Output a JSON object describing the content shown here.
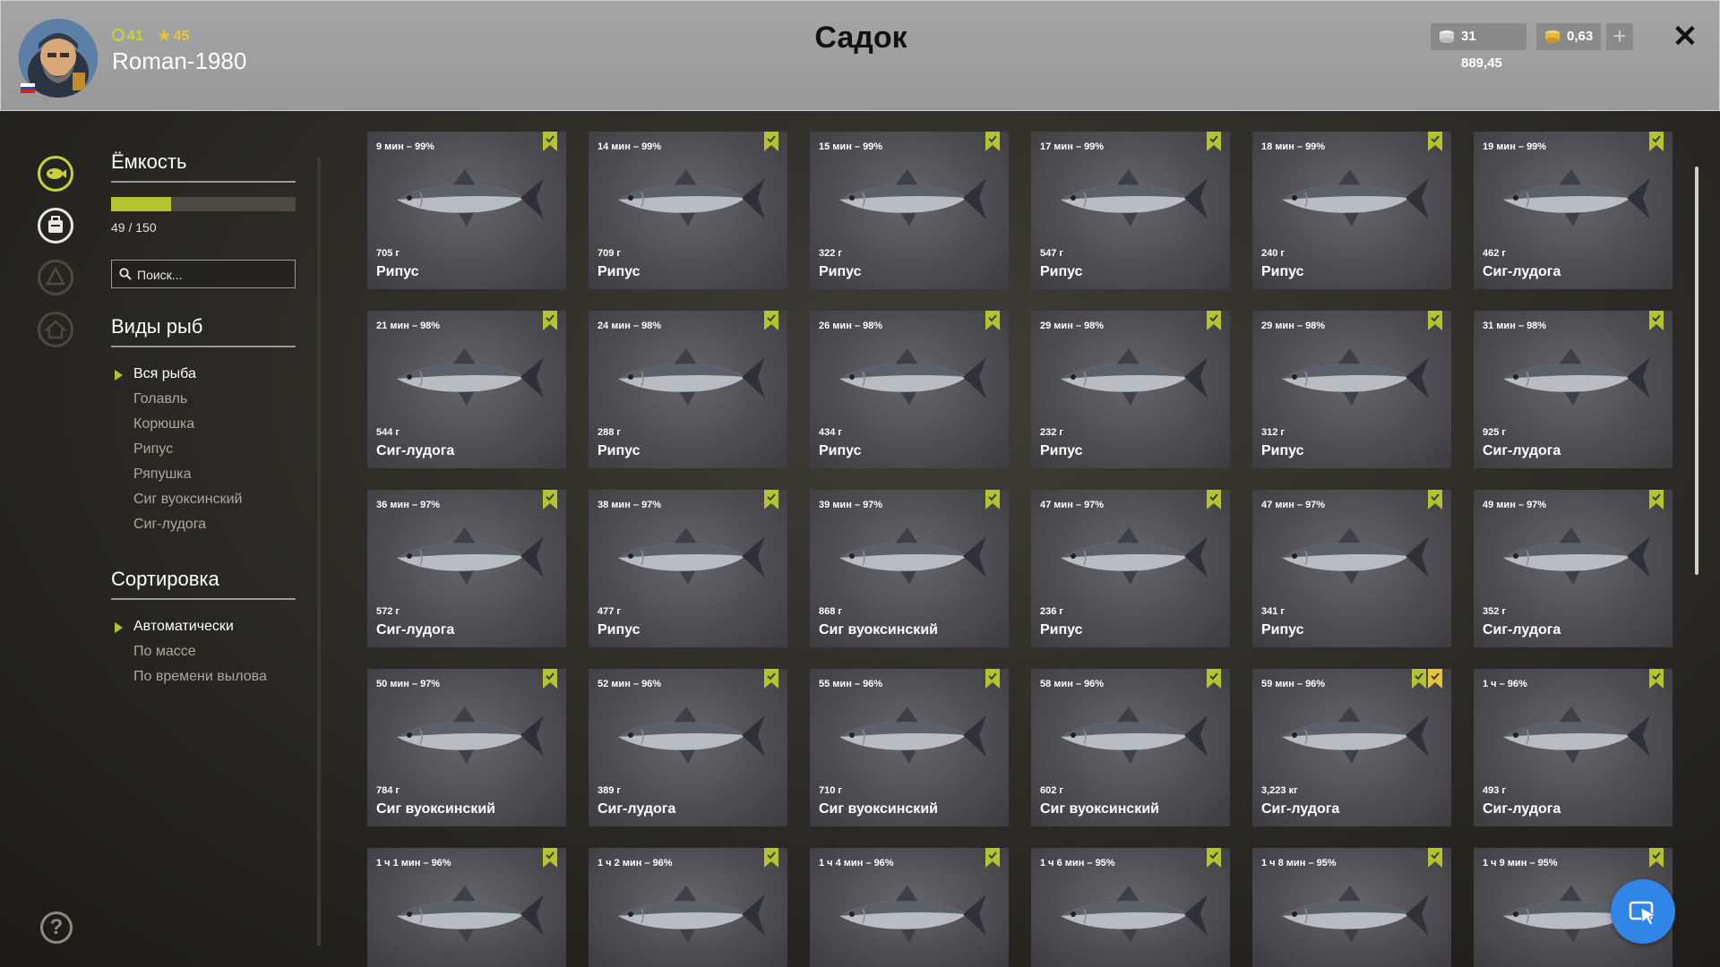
{
  "header": {
    "title": "Садок",
    "username": "Roman-1980",
    "level": "41",
    "rank": "45",
    "silver": "31 889,45",
    "gold": "0,63",
    "add_label": "+",
    "close_label": "✕"
  },
  "filters": {
    "capacity_title": "Ёмкость",
    "capacity_text": "49 / 150",
    "capacity_fraction": 0.3267,
    "search_placeholder": "Поиск...",
    "species_title": "Виды рыб",
    "species": [
      "Вся рыба",
      "Голавль",
      "Корюшка",
      "Рипус",
      "Ряпушка",
      "Сиг вуоксинский",
      "Сиг-лудога"
    ],
    "species_active": 0,
    "sort_title": "Сортировка",
    "sort": [
      "Автоматически",
      "По массе",
      "По времени вылова"
    ],
    "sort_active": 0
  },
  "help_label": "?",
  "colors": {
    "accent": "#b3c42f",
    "header": "#9e9e9e",
    "bookmark": "#b3c42f",
    "bookmark_gold": "#e7c63b",
    "fab": "#2f86e6"
  },
  "fish": [
    {
      "time": "9 мин – 99%",
      "weight": "705 г",
      "name": "Рипус",
      "bookmarks": 1
    },
    {
      "time": "14 мин – 99%",
      "weight": "709 г",
      "name": "Рипус",
      "bookmarks": 1
    },
    {
      "time": "15 мин – 99%",
      "weight": "322 г",
      "name": "Рипус",
      "bookmarks": 1
    },
    {
      "time": "17 мин – 99%",
      "weight": "547 г",
      "name": "Рипус",
      "bookmarks": 1
    },
    {
      "time": "18 мин – 99%",
      "weight": "240 г",
      "name": "Рипус",
      "bookmarks": 1
    },
    {
      "time": "19 мин – 99%",
      "weight": "462 г",
      "name": "Сиг-лудога",
      "bookmarks": 1
    },
    {
      "time": "21 мин – 98%",
      "weight": "544 г",
      "name": "Сиг-лудога",
      "bookmarks": 1
    },
    {
      "time": "24 мин – 98%",
      "weight": "288 г",
      "name": "Рипус",
      "bookmarks": 1
    },
    {
      "time": "26 мин – 98%",
      "weight": "434 г",
      "name": "Рипус",
      "bookmarks": 1
    },
    {
      "time": "29 мин – 98%",
      "weight": "232 г",
      "name": "Рипус",
      "bookmarks": 1
    },
    {
      "time": "29 мин – 98%",
      "weight": "312 г",
      "name": "Рипус",
      "bookmarks": 1
    },
    {
      "time": "31 мин – 98%",
      "weight": "925 г",
      "name": "Сиг-лудога",
      "bookmarks": 1
    },
    {
      "time": "36 мин – 97%",
      "weight": "572 г",
      "name": "Сиг-лудога",
      "bookmarks": 1
    },
    {
      "time": "38 мин – 97%",
      "weight": "477 г",
      "name": "Рипус",
      "bookmarks": 1
    },
    {
      "time": "39 мин – 97%",
      "weight": "868 г",
      "name": "Сиг вуоксинский",
      "bookmarks": 1
    },
    {
      "time": "47 мин – 97%",
      "weight": "236 г",
      "name": "Рипус",
      "bookmarks": 1
    },
    {
      "time": "47 мин – 97%",
      "weight": "341 г",
      "name": "Рипус",
      "bookmarks": 1
    },
    {
      "time": "49 мин – 97%",
      "weight": "352 г",
      "name": "Сиг-лудога",
      "bookmarks": 1
    },
    {
      "time": "50 мин – 97%",
      "weight": "784 г",
      "name": "Сиг вуоксинский",
      "bookmarks": 1
    },
    {
      "time": "52 мин – 96%",
      "weight": "389 г",
      "name": "Сиг-лудога",
      "bookmarks": 1
    },
    {
      "time": "55 мин – 96%",
      "weight": "710 г",
      "name": "Сиг вуоксинский",
      "bookmarks": 1
    },
    {
      "time": "58 мин – 96%",
      "weight": "602 г",
      "name": "Сиг вуоксинский",
      "bookmarks": 1
    },
    {
      "time": "59 мин – 96%",
      "weight": "3,223 кг",
      "name": "Сиг-лудога",
      "bookmarks": 2
    },
    {
      "time": "1 ч – 96%",
      "weight": "493 г",
      "name": "Сиг-лудога",
      "bookmarks": 1
    },
    {
      "time": "1 ч 1 мин – 96%",
      "weight": "",
      "name": "",
      "bookmarks": 1
    },
    {
      "time": "1 ч 2 мин – 96%",
      "weight": "",
      "name": "",
      "bookmarks": 1
    },
    {
      "time": "1 ч 4 мин – 96%",
      "weight": "",
      "name": "",
      "bookmarks": 1
    },
    {
      "time": "1 ч 6 мин – 95%",
      "weight": "",
      "name": "",
      "bookmarks": 1
    },
    {
      "time": "1 ч 8 мин – 95%",
      "weight": "",
      "name": "",
      "bookmarks": 1
    },
    {
      "time": "1 ч 9 мин – 95%",
      "weight": "",
      "name": "",
      "bookmarks": 1
    }
  ]
}
